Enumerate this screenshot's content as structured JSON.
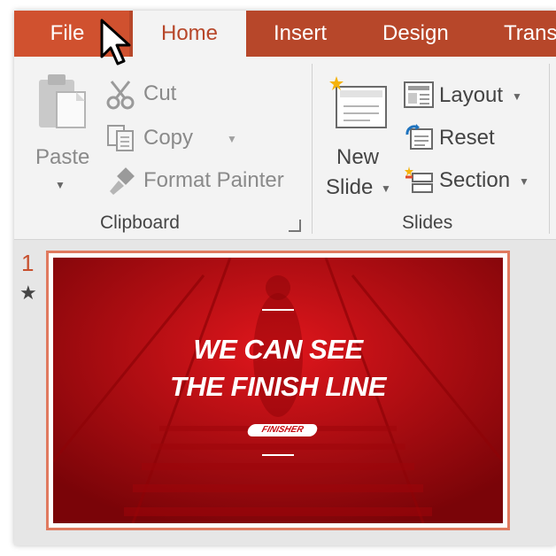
{
  "tabs": {
    "file": "File",
    "home": "Home",
    "insert": "Insert",
    "design": "Design",
    "transitions": "Trans"
  },
  "clipboard": {
    "paste": "Paste",
    "cut": "Cut",
    "copy": "Copy",
    "format_painter": "Format Painter",
    "group_label": "Clipboard"
  },
  "slides_group": {
    "new_slide_line1": "New",
    "new_slide_line2": "Slide",
    "layout": "Layout",
    "reset": "Reset",
    "section": "Section",
    "group_label": "Slides"
  },
  "thumbnail": {
    "number": "1",
    "star": "★",
    "title_line1": "WE CAN SEE",
    "title_line2": "THE FINISH LINE",
    "badge": "FINISHER"
  },
  "colors": {
    "tabbar": "#b7472a",
    "file_tab": "#d0512f",
    "slide_bg": "#c40a10",
    "selection_border": "#e07a5f"
  }
}
